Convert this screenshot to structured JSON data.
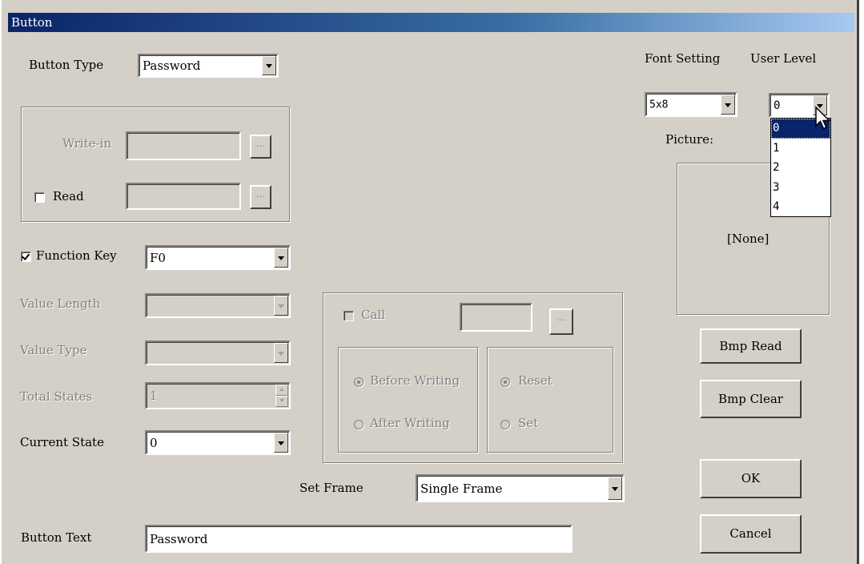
{
  "window": {
    "title": "Button"
  },
  "button_type": {
    "label": "Button Type",
    "value": "Password"
  },
  "write_in": {
    "label": "Write-in",
    "value": "",
    "browse_label": "..."
  },
  "read": {
    "label": "Read",
    "checked": false,
    "value": "",
    "browse_label": "..."
  },
  "function_key": {
    "label": "Function Key",
    "checked": true,
    "value": "F0"
  },
  "value_length": {
    "label": "Value Length",
    "value": ""
  },
  "value_type": {
    "label": "Value Type",
    "value": ""
  },
  "total_states": {
    "label": "Total States",
    "value": "1"
  },
  "current_state": {
    "label": "Current State",
    "value": "0"
  },
  "call": {
    "label": "Call",
    "checked": false,
    "value": "",
    "browse_label": "...",
    "timing": {
      "before_label": "Before Writing",
      "after_label": "After Writing",
      "selected": "Before Writing"
    },
    "action": {
      "reset_label": "Reset",
      "set_label": "Set",
      "selected": "Reset"
    }
  },
  "set_frame": {
    "label": "Set Frame",
    "value": "Single Frame"
  },
  "button_text": {
    "label": "Button Text",
    "value": "Password"
  },
  "font_setting": {
    "label": "Font Setting",
    "value": "5x8"
  },
  "user_level": {
    "label": "User Level",
    "value": "0",
    "options": [
      "0",
      "1",
      "2",
      "3",
      "4"
    ],
    "highlighted": "0"
  },
  "picture": {
    "label": "Picture:",
    "value": "[None]"
  },
  "buttons": {
    "bmp_read": "Bmp Read",
    "bmp_clear": "Bmp Clear",
    "ok": "OK",
    "cancel": "Cancel"
  }
}
